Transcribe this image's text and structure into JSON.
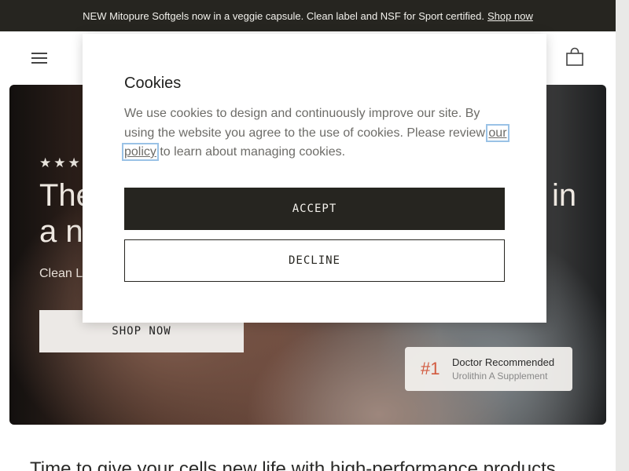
{
  "announcement": {
    "text": "NEW Mitopure Softgels now in a veggie capsule. Clean label and NSF for Sport certified.",
    "link": "Shop now"
  },
  "header": {
    "menu_icon": "hamburger-menu-icon",
    "cart_icon": "shopping-bag-icon"
  },
  "hero": {
    "stars": "★★★",
    "title_line1": "The",
    "title_line2": "a ne",
    "title_trailing": "in",
    "subtitle": "Clean L",
    "shop_button": "SHOP NOW",
    "badge": {
      "number": "#1",
      "title": "Doctor Recommended",
      "subtitle": "Urolithin A Supplement"
    }
  },
  "lower": {
    "text": "Time to give your cells new life with high-performance products"
  },
  "cookie_modal": {
    "title": "Cookies",
    "body_before": "We use cookies to design and continuously improve our site. By using the website you agree to the use of cookies. Please review ",
    "policy_link": "our policy",
    "body_after": " to learn about managing cookies.",
    "accept_label": "ACCEPT",
    "decline_label": "DECLINE"
  },
  "colors": {
    "dark": "#262520",
    "accent_badge": "#d25a3f",
    "focus_outline": "#9ac2e6"
  }
}
